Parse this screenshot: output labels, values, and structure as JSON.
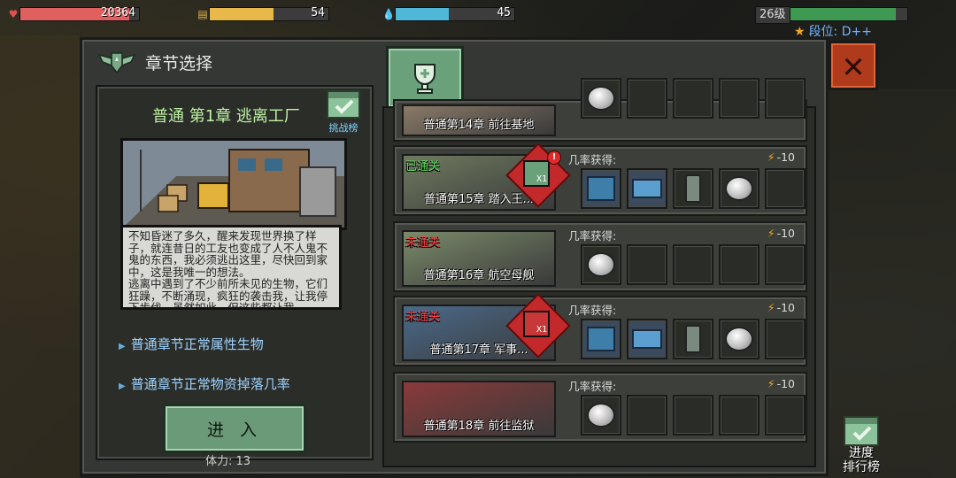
{
  "hud": {
    "health": {
      "value": "20364",
      "fill": 0.92,
      "color": "#e06060"
    },
    "food": {
      "value": "54",
      "fill": 0.54,
      "color": "#e8b84a"
    },
    "water": {
      "value": "45",
      "fill": 0.45,
      "color": "#4fb8d8"
    },
    "level": "26级",
    "exp_fill": 0.9,
    "exp_color": "#3e9a52",
    "rank": "段位: D++"
  },
  "panel": {
    "title": "章节选择",
    "tab_icon": "trophy-icon",
    "close_icon": "close-icon"
  },
  "selected": {
    "chapter_title": "普通 第1章 逃离工厂",
    "challenge_label": "挑战榜",
    "description": "不知昏迷了多久，醒来发现世界换了样子，就连昔日的工友也变成了人不人鬼不鬼的东西，我必须逃出这里，尽快回到家中，这是我唯一的想法。\n逃离中遇到了不少前所未见的生物，它们狂躁，不断涌现，疯狂的袭击我，让我停下步伐，虽然如此，但这些都让我...",
    "info": [
      "普通章节正常属性生物",
      "普通章节正常物资掉落几率"
    ],
    "enter_label": "进 入",
    "stamina": "体力: 13"
  },
  "chapters": [
    {
      "name": "普通第14章 前往基地",
      "status": "",
      "status_color": "",
      "prob_label": "",
      "cost": "",
      "slots": [
        "coin",
        "empty",
        "empty",
        "empty",
        "empty"
      ],
      "badge": false,
      "alert": false,
      "bg": "#8a7a68"
    },
    {
      "name": "普通第15章 踏入王...",
      "status": "已通关",
      "status_color": "#5ee05e",
      "prob_label": "几率获得:",
      "cost": "-10",
      "slots": [
        "box",
        "gun",
        "bottle",
        "coin",
        "empty"
      ],
      "badge": true,
      "badge_count": "X1",
      "badge_color": "#6aa07a",
      "alert": true,
      "alert_text": "!",
      "bg": "#6f7a60"
    },
    {
      "name": "普通第16章 航空母舰",
      "status": "未通关",
      "status_color": "#ff4040",
      "prob_label": "几率获得:",
      "cost": "-10",
      "slots": [
        "coin",
        "empty",
        "empty",
        "empty",
        "empty"
      ],
      "badge": false,
      "alert": false,
      "bg": "#7a8a6a"
    },
    {
      "name": "普通第17章 军事...",
      "status": "未通关",
      "status_color": "#ff4040",
      "prob_label": "几率获得:",
      "cost": "-10",
      "slots": [
        "box",
        "gun",
        "bottle",
        "coin",
        "empty"
      ],
      "badge": true,
      "badge_count": "X1",
      "badge_color": "#c83838",
      "alert": false,
      "bg": "#4a6a8a"
    },
    {
      "name": "普通第18章 前往监狱",
      "status": "",
      "status_color": "",
      "prob_label": "几率获得:",
      "cost": "-10",
      "slots": [
        "coin",
        "empty",
        "empty",
        "empty",
        "empty"
      ],
      "badge": false,
      "alert": false,
      "bg": "#8a3a3a"
    }
  ],
  "progress_label": "进度\n排行榜"
}
